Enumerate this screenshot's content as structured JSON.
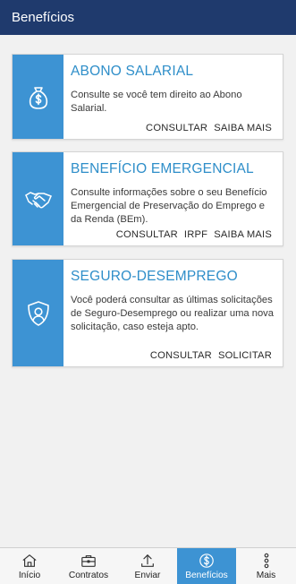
{
  "header": {
    "title": "Benefícios"
  },
  "cards": [
    {
      "title": "ABONO SALARIAL",
      "icon": "money-bag-icon",
      "description": "Consulte se você tem direito ao Abono Salarial.",
      "actions": [
        "CONSULTAR",
        "SAIBA MAIS"
      ]
    },
    {
      "title": "BENEFÍCIO EMERGENCIAL",
      "icon": "handshake-icon",
      "description": "Consulte informações sobre o seu Benefício Emergencial de Preservação do Emprego e da Renda (BEm).",
      "actions": [
        "CONSULTAR",
        "IRPF",
        "SAIBA MAIS"
      ]
    },
    {
      "title": "SEGURO-DESEMPREGO",
      "icon": "shield-person-icon",
      "description": "Você poderá consultar as últimas solicitações de Seguro-Desemprego ou realizar uma nova solicitação, caso esteja apto.",
      "actions": [
        "CONSULTAR",
        "SOLICITAR"
      ]
    }
  ],
  "bottom_nav": {
    "items": [
      {
        "label": "Início",
        "icon": "home-icon"
      },
      {
        "label": "Contratos",
        "icon": "briefcase-icon"
      },
      {
        "label": "Enviar",
        "icon": "upload-icon"
      },
      {
        "label": "Benefícios",
        "icon": "dollar-circle-icon",
        "active": true
      },
      {
        "label": "Mais",
        "icon": "more-dots-icon"
      }
    ]
  },
  "colors": {
    "header": "#1f3a6d",
    "accent": "#3d93d3",
    "card_title": "#2e8ec9",
    "background": "#f1f1f1"
  }
}
